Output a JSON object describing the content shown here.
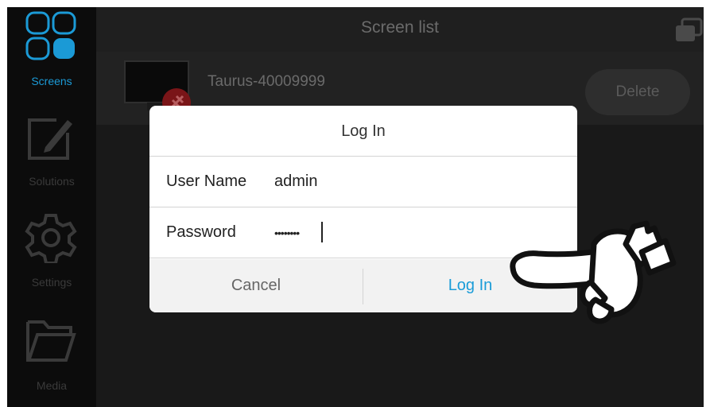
{
  "sidebar": {
    "items": [
      {
        "label": "Screens",
        "icon": "screens-grid-icon",
        "active": true
      },
      {
        "label": "Solutions",
        "icon": "edit-pencil-icon",
        "active": false
      },
      {
        "label": "Settings",
        "icon": "gear-icon",
        "active": false
      },
      {
        "label": "Media",
        "icon": "folder-icon",
        "active": false
      }
    ]
  },
  "header": {
    "title": "Screen list",
    "right_icon": "window-switch-icon"
  },
  "screen_list": {
    "items": [
      {
        "name": "Taurus-40009999",
        "delete_label": "Delete",
        "status_icon": "disconnected-badge-icon"
      }
    ]
  },
  "login_dialog": {
    "title": "Log In",
    "username_label": "User Name",
    "username_value": "admin",
    "password_label": "Password",
    "password_value": "••••••••",
    "cancel_label": "Cancel",
    "login_label": "Log In"
  },
  "colors": {
    "accent": "#1b9ad6",
    "background": "#121212"
  }
}
